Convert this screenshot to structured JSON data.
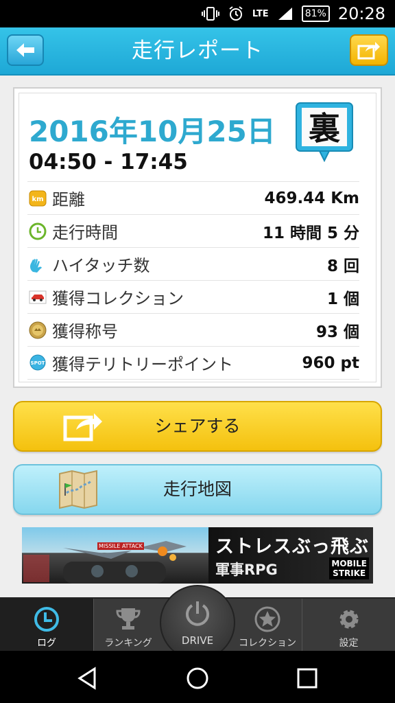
{
  "status_bar": {
    "network": "LTE",
    "battery": "81%",
    "time": "20:28"
  },
  "header": {
    "title": "走行レポート"
  },
  "report": {
    "date": "2016年10月25日",
    "time_range": "04:50 - 17:45",
    "badge_char": "裏",
    "stats": [
      {
        "icon": "km-icon",
        "label": "距離",
        "value": "469.44 Km"
      },
      {
        "icon": "clock-icon",
        "label": "走行時間",
        "value": "11 時間 5 分"
      },
      {
        "icon": "hi-five-icon",
        "label": "ハイタッチ数",
        "value": "8 回"
      },
      {
        "icon": "car-icon",
        "label": "獲得コレクション",
        "value": "1 個"
      },
      {
        "icon": "medal-icon",
        "label": "獲得称号",
        "value": "93 個"
      },
      {
        "icon": "spot-icon",
        "label": "獲得テリトリーポイント",
        "value": "960 pt"
      }
    ]
  },
  "buttons": {
    "share_label": "シェアする",
    "map_label": "走行地図"
  },
  "ad": {
    "headline": "ストレスぶっ飛ぶ",
    "sub": "軍事RPG",
    "brand_line1": "MOBILE",
    "brand_line2": "STRIKE",
    "small_text": "MISSILE ATTACK"
  },
  "bottom_nav": {
    "items": [
      {
        "label": "ログ"
      },
      {
        "label": "ランキング"
      },
      {
        "label": "DRIVE"
      },
      {
        "label": "コレクション"
      },
      {
        "label": "設定"
      }
    ]
  },
  "colors": {
    "header": "#1ea8d6",
    "date": "#2ea9cf",
    "share": "#f4c10e",
    "map": "#86d7ee"
  }
}
